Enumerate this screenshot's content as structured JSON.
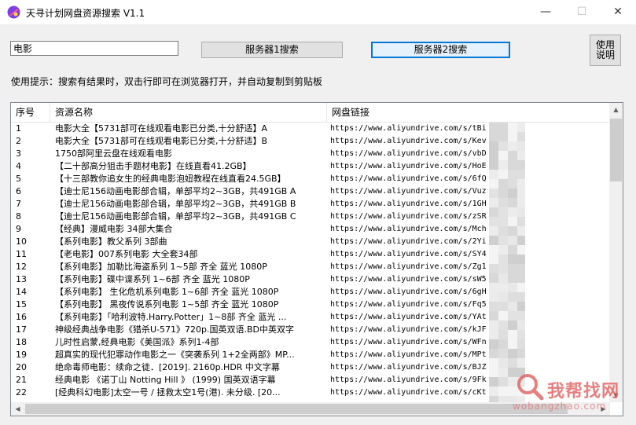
{
  "window": {
    "title": "天寻计划网盘资源搜索 V1.1",
    "minimize": "—",
    "maximize": "☐",
    "close": "✕"
  },
  "search": {
    "value": "电影"
  },
  "buttons": {
    "server1": "服务器1搜索",
    "server2": "服务器2搜索",
    "help_line1": "使用",
    "help_line2": "说明"
  },
  "tip": "使用提示：搜索有结果时，双击行即可在浏览器打开，并自动复制到剪贴板",
  "columns": [
    "序号",
    "资源名称",
    "网盘链接"
  ],
  "rows": [
    [
      "1",
      "电影大全【5731部可在线观看电影已分类,十分舒适】A",
      "https://www.aliyundrive.com/s/tBi"
    ],
    [
      "2",
      "电影大全【5731部可在线观看电影已分类,十分舒适】B",
      "https://www.aliyundrive.com/s/Kev"
    ],
    [
      "3",
      "1750部阿里云盘在线观看电影",
      "https://www.aliyundrive.com/s/vbD"
    ],
    [
      "4",
      "【二十部高分狙击手题材电影】在线直看41.2GB】",
      "https://www.aliyundrive.com/s/HoE"
    ],
    [
      "5",
      "【十三部教你追女生的经典电影泡妞教程在线直看24.5GB】",
      "https://www.aliyundrive.com/s/6fQ"
    ],
    [
      "6",
      "【迪士尼156动画电影部合辑，单部平均2~3GB，共491GB  A",
      "https://www.aliyundrive.com/s/Vuz"
    ],
    [
      "7",
      "【迪士尼156动画电影部合辑，单部平均2~3GB，共491GB  B",
      "https://www.aliyundrive.com/s/1GH"
    ],
    [
      "8",
      "【迪士尼156动画电影部合辑，单部平均2~3GB，共491GB  C",
      "https://www.aliyundrive.com/s/zSR"
    ],
    [
      "9",
      "【经典】漫威电影 34部大集合",
      "https://www.aliyundrive.com/s/Mch"
    ],
    [
      "10",
      "【系列电影】教父系列 3部曲",
      "https://www.aliyundrive.com/s/2Yi"
    ],
    [
      "11",
      "【老电影】007系列电影 大全套34部",
      "https://www.aliyundrive.com/s/SY4"
    ],
    [
      "12",
      "【系列电影】加勒比海盗系列 1~5部 齐全 蓝光 1080P",
      "https://www.aliyundrive.com/s/Zg1"
    ],
    [
      "13",
      "【系列电影】碟中谍系列 1~6部 齐全 蓝光 1080P",
      "https://www.aliyundrive.com/s/sW5"
    ],
    [
      "14",
      "【系列电影】 生化危机系列电影 1~6部 齐全 蓝光 1080P",
      "https://www.aliyundrive.com/s/6gH"
    ],
    [
      "15",
      "【系列电影】 黑夜传说系列电影 1~5部 齐全 蓝光 1080P",
      "https://www.aliyundrive.com/s/Fq5"
    ],
    [
      "16",
      "【系列电影】「哈利波特.Harry.Potter」1~8部 齐全 蓝光 ...",
      "https://www.aliyundrive.com/s/YAt"
    ],
    [
      "17",
      "神级经典战争电影《猎杀U-571》720p.国英双语.BD中英双字",
      "https://www.aliyundrive.com/s/kJF"
    ],
    [
      "18",
      "儿时性启蒙,经典电影《美国派》系列1-4部",
      "https://www.aliyundrive.com/s/WFn"
    ],
    [
      "19",
      "超真实的现代犯罪动作电影之一《突袭系列 1+2全两部》MP...",
      "https://www.aliyundrive.com/s/MPt"
    ],
    [
      "20",
      "绝命毒师电影：续命之徒．[2019].  2160p.HDR 中文字幕",
      "https://www.aliyundrive.com/s/BJZ"
    ],
    [
      "21",
      "经典电影 《诺丁山 Notting Hill 》 (1999) 国英双语字幕",
      "https://www.aliyundrive.com/s/9Fk"
    ],
    [
      "22",
      "[经典科幻电影]太空一号 / 拯救太空1号(港). 未分级. [20...",
      "https://www.aliyundrive.com/s/cKt"
    ]
  ],
  "watermark": {
    "text": "我帮找网",
    "sub": "wobangzhao.com"
  },
  "colors": {
    "accent": "#0078d7",
    "watermark": "#e06060"
  }
}
